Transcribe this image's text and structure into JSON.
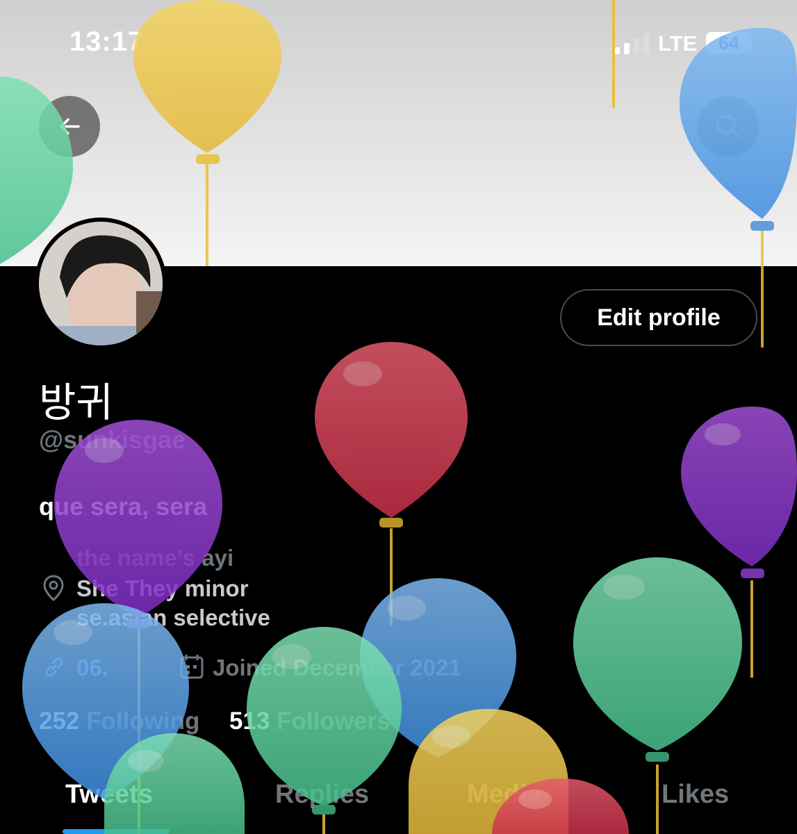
{
  "status_bar": {
    "time": "13:17",
    "network": "LTE",
    "battery": "64"
  },
  "header": {
    "back_icon": "back-arrow-icon",
    "search_icon": "search-icon"
  },
  "profile": {
    "display_name": "방귀",
    "handle": "@sunkisgae",
    "bio_title": "que sera, sera",
    "bio_lines": [
      "the name's ayi",
      "She They minor",
      "se.asian selective"
    ],
    "link_text": "06.",
    "joined_text": "Joined December 2021",
    "following_count": "252",
    "following_label": "Following",
    "followers_count": "513",
    "followers_label": "Followers",
    "edit_button": "Edit profile"
  },
  "tabs": [
    {
      "label": "Tweets",
      "active": true
    },
    {
      "label": "Replies",
      "active": false
    },
    {
      "label": "Media",
      "active": false
    },
    {
      "label": "Likes",
      "active": false
    }
  ],
  "colors": {
    "accent": "#1d9bf0",
    "muted": "#6e767d",
    "background": "#000000"
  }
}
